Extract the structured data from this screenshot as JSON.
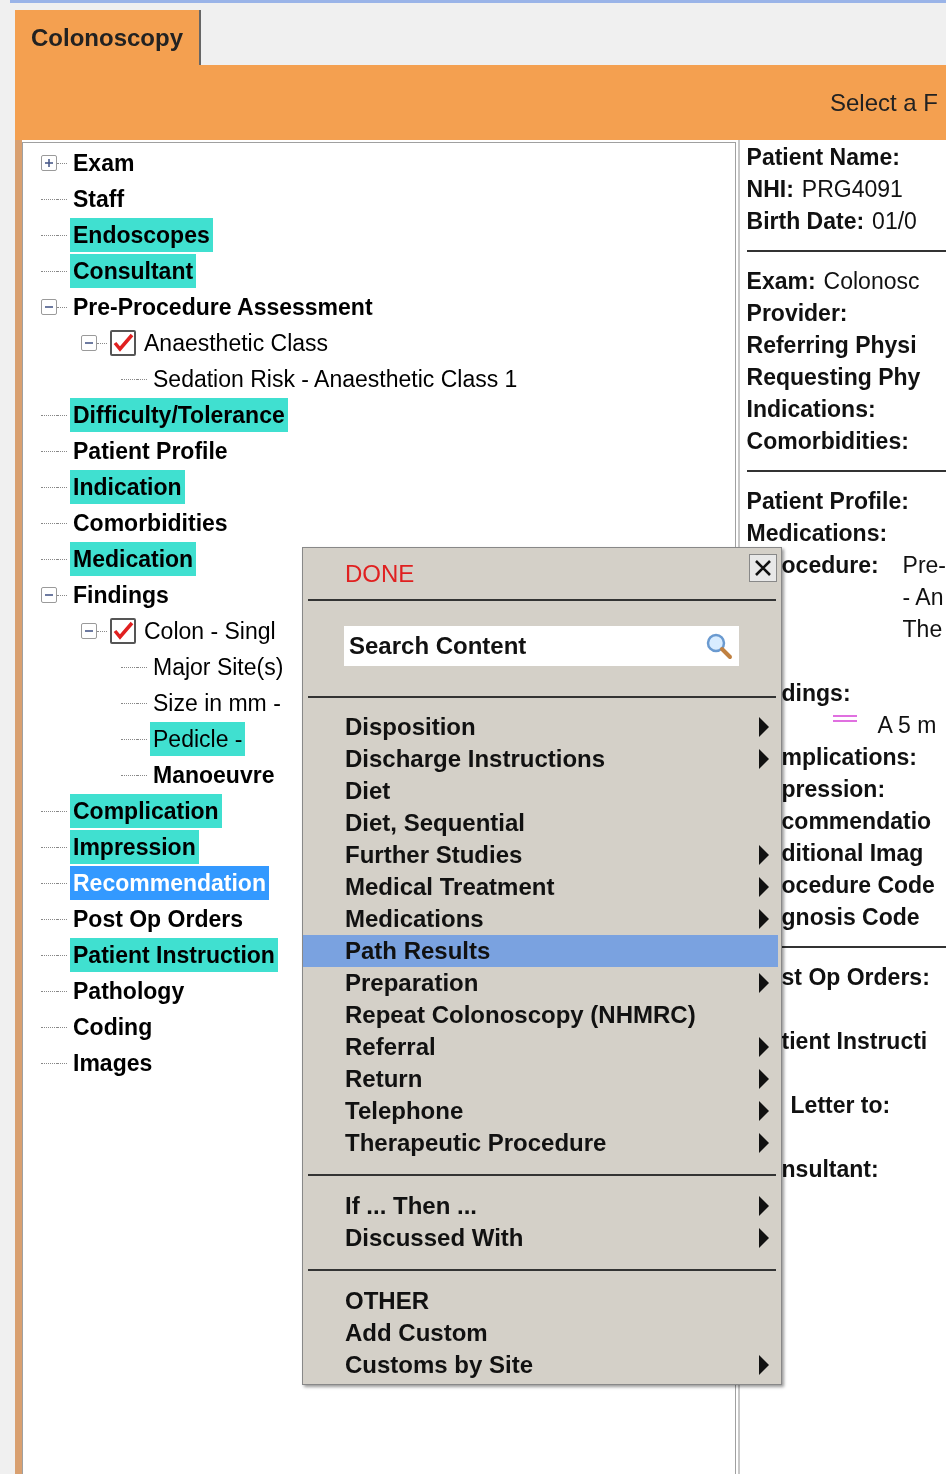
{
  "tabs": [
    {
      "label": "Colonoscopy",
      "selected": true
    }
  ],
  "banner": {
    "prompt": "Select a F"
  },
  "tree": [
    {
      "label": "Exam",
      "kind": "heading",
      "highlighted": false,
      "selected": false,
      "expanded": false
    },
    {
      "label": "Staff",
      "kind": "heading",
      "highlighted": false,
      "selected": false
    },
    {
      "label": "Endoscopes",
      "kind": "heading",
      "highlighted": true,
      "selected": false
    },
    {
      "label": "Consultant",
      "kind": "heading",
      "highlighted": true,
      "selected": false
    },
    {
      "label": "Pre-Procedure Assessment",
      "kind": "heading",
      "highlighted": false,
      "selected": false,
      "expanded": true,
      "children": [
        {
          "label": "Anaesthetic Class",
          "kind": "entry",
          "highlighted": false,
          "selected": false,
          "expanded": true,
          "checked": true,
          "children": [
            {
              "label": "Sedation Risk - Anaesthetic Class 1",
              "kind": "entry",
              "highlighted": false,
              "selected": false
            }
          ]
        }
      ]
    },
    {
      "label": "Difficulty/Tolerance",
      "kind": "heading",
      "highlighted": true,
      "selected": false
    },
    {
      "label": "Patient Profile",
      "kind": "heading",
      "highlighted": false,
      "selected": false
    },
    {
      "label": "Indication",
      "kind": "heading",
      "highlighted": true,
      "selected": false
    },
    {
      "label": "Comorbidities",
      "kind": "heading",
      "highlighted": false,
      "selected": false
    },
    {
      "label": "Medication",
      "kind": "heading",
      "highlighted": true,
      "selected": false
    },
    {
      "label": "Findings",
      "kind": "heading",
      "highlighted": false,
      "selected": false,
      "expanded": true,
      "children": [
        {
          "label": "Colon - Singl",
          "kind": "entry",
          "highlighted": false,
          "selected": false,
          "expanded": true,
          "checked": true,
          "children": [
            {
              "label": "Major Site(s)",
              "kind": "entry",
              "highlighted": false,
              "selected": false
            },
            {
              "label": "Size in mm -",
              "kind": "entry",
              "highlighted": false,
              "selected": false
            },
            {
              "label": "Pedicle -",
              "kind": "entry",
              "highlighted": true,
              "selected": false
            },
            {
              "label": "Manoeuvre",
              "kind": "heading",
              "highlighted": false,
              "selected": false
            }
          ]
        }
      ]
    },
    {
      "label": "Complication",
      "kind": "heading",
      "highlighted": true,
      "selected": false
    },
    {
      "label": "Impression",
      "kind": "heading",
      "highlighted": true,
      "selected": false
    },
    {
      "label": "Recommendation",
      "kind": "heading",
      "selected": true
    },
    {
      "label": "Post Op Orders",
      "kind": "heading",
      "highlighted": false,
      "selected": false
    },
    {
      "label": "Patient Instruction",
      "kind": "heading",
      "highlighted": true,
      "selected": false
    },
    {
      "label": "Pathology",
      "kind": "heading",
      "highlighted": false,
      "selected": false
    },
    {
      "label": "Coding",
      "kind": "heading",
      "highlighted": false,
      "selected": false
    },
    {
      "label": "Images",
      "kind": "heading",
      "highlighted": false,
      "selected": false
    }
  ],
  "report": {
    "lines": [
      {
        "kind": "full",
        "label": "Patient Name:"
      },
      {
        "kind": "full",
        "label": "NHI:",
        "value": "PRG4091"
      },
      {
        "kind": "full",
        "label": "Birth Date:",
        "value": "01/0"
      },
      {
        "kind": "full",
        "label": "Exam:",
        "value": "Colonosc",
        "divider_before": true
      },
      {
        "kind": "full",
        "label": "Provider:"
      },
      {
        "kind": "full",
        "label": "Referring Physi"
      },
      {
        "kind": "full",
        "label": "Requesting Phy"
      },
      {
        "kind": "full",
        "label": "Indications:"
      },
      {
        "kind": "full",
        "label": "Comorbidities:"
      },
      {
        "kind": "full",
        "label": "Patient Profile:",
        "divider_before": true
      },
      {
        "kind": "full",
        "label": "Medications:"
      },
      {
        "kind": "clipped",
        "label": "ocedure:",
        "value": "Pre-"
      },
      {
        "kind": "clipped",
        "value": "- An"
      },
      {
        "kind": "clipped",
        "value": "The"
      },
      {
        "kind": "clipped",
        "label": "dings:",
        "space_before": true
      },
      {
        "kind": "finding",
        "value": "A 5 m"
      },
      {
        "kind": "clipped",
        "label": "mplications:"
      },
      {
        "kind": "clipped",
        "label": "pression:"
      },
      {
        "kind": "clipped",
        "label": "commendatio"
      },
      {
        "kind": "clipped",
        "label": "ditional Imag"
      },
      {
        "kind": "clipped",
        "label": "ocedure Code"
      },
      {
        "kind": "clipped",
        "label": "gnosis Code"
      },
      {
        "kind": "clipped",
        "label": "st Op Orders:",
        "divider_before": true
      },
      {
        "kind": "clipped",
        "label": "tient Instructi",
        "space_before": true
      },
      {
        "kind": "indented",
        "label": "Letter to:",
        "space_before": true
      },
      {
        "kind": "clipped",
        "label": "nsultant:",
        "space_before": true
      }
    ]
  },
  "menu": {
    "done": "DONE",
    "search": {
      "placeholder": "Search Content"
    },
    "groups": [
      {
        "items": [
          {
            "label": "Disposition",
            "submenu": true,
            "selected": false
          },
          {
            "label": "Discharge Instructions",
            "submenu": true,
            "selected": false
          },
          {
            "label": "Diet",
            "submenu": false,
            "selected": false
          },
          {
            "label": "Diet, Sequential",
            "submenu": false,
            "selected": false
          },
          {
            "label": "Further Studies",
            "submenu": true,
            "selected": false
          },
          {
            "label": "Medical Treatment",
            "submenu": true,
            "selected": false
          },
          {
            "label": "Medications",
            "submenu": true,
            "selected": false
          },
          {
            "label": "Path Results",
            "submenu": false,
            "selected": true
          },
          {
            "label": "Preparation",
            "submenu": true,
            "selected": false
          },
          {
            "label": "Repeat Colonoscopy (NHMRC)",
            "submenu": false,
            "selected": false
          },
          {
            "label": "Referral",
            "submenu": true,
            "selected": false
          },
          {
            "label": "Return",
            "submenu": true,
            "selected": false
          },
          {
            "label": "Telephone",
            "submenu": true,
            "selected": false
          },
          {
            "label": "Therapeutic Procedure",
            "submenu": true,
            "selected": false
          }
        ]
      },
      {
        "items": [
          {
            "label": "If ... Then ...",
            "submenu": true,
            "selected": false
          },
          {
            "label": "Discussed With",
            "submenu": true,
            "selected": false
          }
        ]
      },
      {
        "items": [
          {
            "label": "OTHER",
            "submenu": false,
            "selected": false
          },
          {
            "label": "Add Custom",
            "submenu": false,
            "selected": false
          },
          {
            "label": "Customs by Site",
            "submenu": true,
            "selected": false
          }
        ]
      }
    ]
  }
}
